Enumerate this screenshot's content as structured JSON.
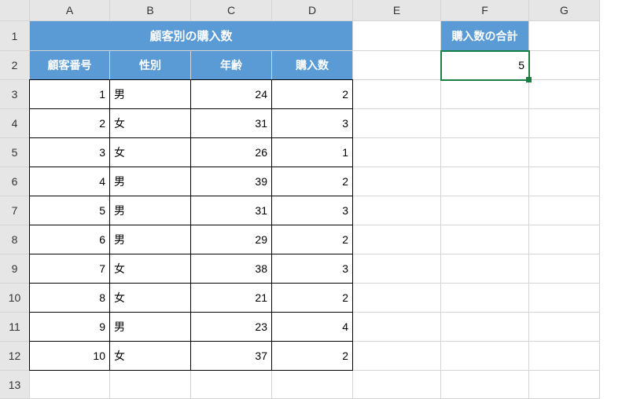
{
  "columns": [
    "A",
    "B",
    "C",
    "D",
    "E",
    "F",
    "G"
  ],
  "rows": [
    "1",
    "2",
    "3",
    "4",
    "5",
    "6",
    "7",
    "8",
    "9",
    "10",
    "11",
    "12",
    "13"
  ],
  "main_title": "顧客別の購入数",
  "headers": {
    "customer_id": "顧客番号",
    "gender": "性別",
    "age": "年齢",
    "purchases": "購入数"
  },
  "sum_label": "購入数の合計",
  "sum_value": "5",
  "data_rows": [
    {
      "id": "1",
      "gender": "男",
      "age": "24",
      "purchases": "2"
    },
    {
      "id": "2",
      "gender": "女",
      "age": "31",
      "purchases": "3"
    },
    {
      "id": "3",
      "gender": "女",
      "age": "26",
      "purchases": "1"
    },
    {
      "id": "4",
      "gender": "男",
      "age": "39",
      "purchases": "2"
    },
    {
      "id": "5",
      "gender": "男",
      "age": "31",
      "purchases": "3"
    },
    {
      "id": "6",
      "gender": "男",
      "age": "29",
      "purchases": "2"
    },
    {
      "id": "7",
      "gender": "女",
      "age": "38",
      "purchases": "3"
    },
    {
      "id": "8",
      "gender": "女",
      "age": "21",
      "purchases": "2"
    },
    {
      "id": "9",
      "gender": "男",
      "age": "23",
      "purchases": "4"
    },
    {
      "id": "10",
      "gender": "女",
      "age": "37",
      "purchases": "2"
    }
  ],
  "chart_data": {
    "type": "table",
    "title": "顧客別の購入数",
    "columns": [
      "顧客番号",
      "性別",
      "年齢",
      "購入数"
    ],
    "rows": [
      [
        1,
        "男",
        24,
        2
      ],
      [
        2,
        "女",
        31,
        3
      ],
      [
        3,
        "女",
        26,
        1
      ],
      [
        4,
        "男",
        39,
        2
      ],
      [
        5,
        "男",
        31,
        3
      ],
      [
        6,
        "男",
        29,
        2
      ],
      [
        7,
        "女",
        38,
        3
      ],
      [
        8,
        "女",
        21,
        2
      ],
      [
        9,
        "男",
        23,
        4
      ],
      [
        10,
        "女",
        37,
        2
      ]
    ],
    "summary": {
      "購入数の合計": 5
    }
  }
}
